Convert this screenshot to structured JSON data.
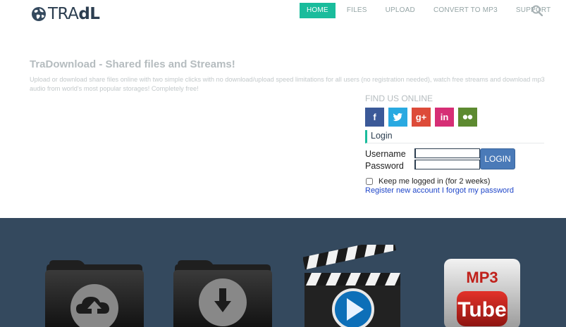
{
  "brand": {
    "name_light": "TRA",
    "name_bold": "dL"
  },
  "nav": {
    "home": "HOME",
    "files": "FILES",
    "upload": "UPLOAD",
    "convert": "CONVERT TO MP3",
    "support": "SUPPORT"
  },
  "intro": {
    "title": "TraDownload - Shared files and Streams!",
    "text": "Upload or download share files online with two simple clicks with no download/upload speed limitations for all users (no registration needed), watch free streams and download mp3 audio from world's most popular storages! Completely free!"
  },
  "social": {
    "title": "FIND US ONLINE",
    "items": [
      {
        "name": "facebook",
        "glyph": "f",
        "color": "#3b5998"
      },
      {
        "name": "twitter",
        "glyph": "t",
        "color": "#29a9e1"
      },
      {
        "name": "google-plus",
        "glyph": "g+",
        "color": "#dd4b39"
      },
      {
        "name": "linkedin",
        "glyph": "in",
        "color": "#d62e75"
      },
      {
        "name": "flickr",
        "glyph": "••",
        "color": "#5d8a30"
      }
    ]
  },
  "login": {
    "heading": "Login",
    "username_label": "Username",
    "password_label": "Password",
    "username_value": "",
    "password_value": "",
    "button": "LOGIN",
    "keep_logged": "Keep me logged in (for 2 weeks)",
    "register": "Register new account",
    "forgot": "I forgot my password"
  },
  "features": {
    "mp3_top": "MP3",
    "mp3_bottom": "Tube"
  },
  "colors": {
    "accent": "#1abc9c",
    "band": "#34495e",
    "login_button": "#4a7ab8",
    "link": "#1f46c9"
  }
}
